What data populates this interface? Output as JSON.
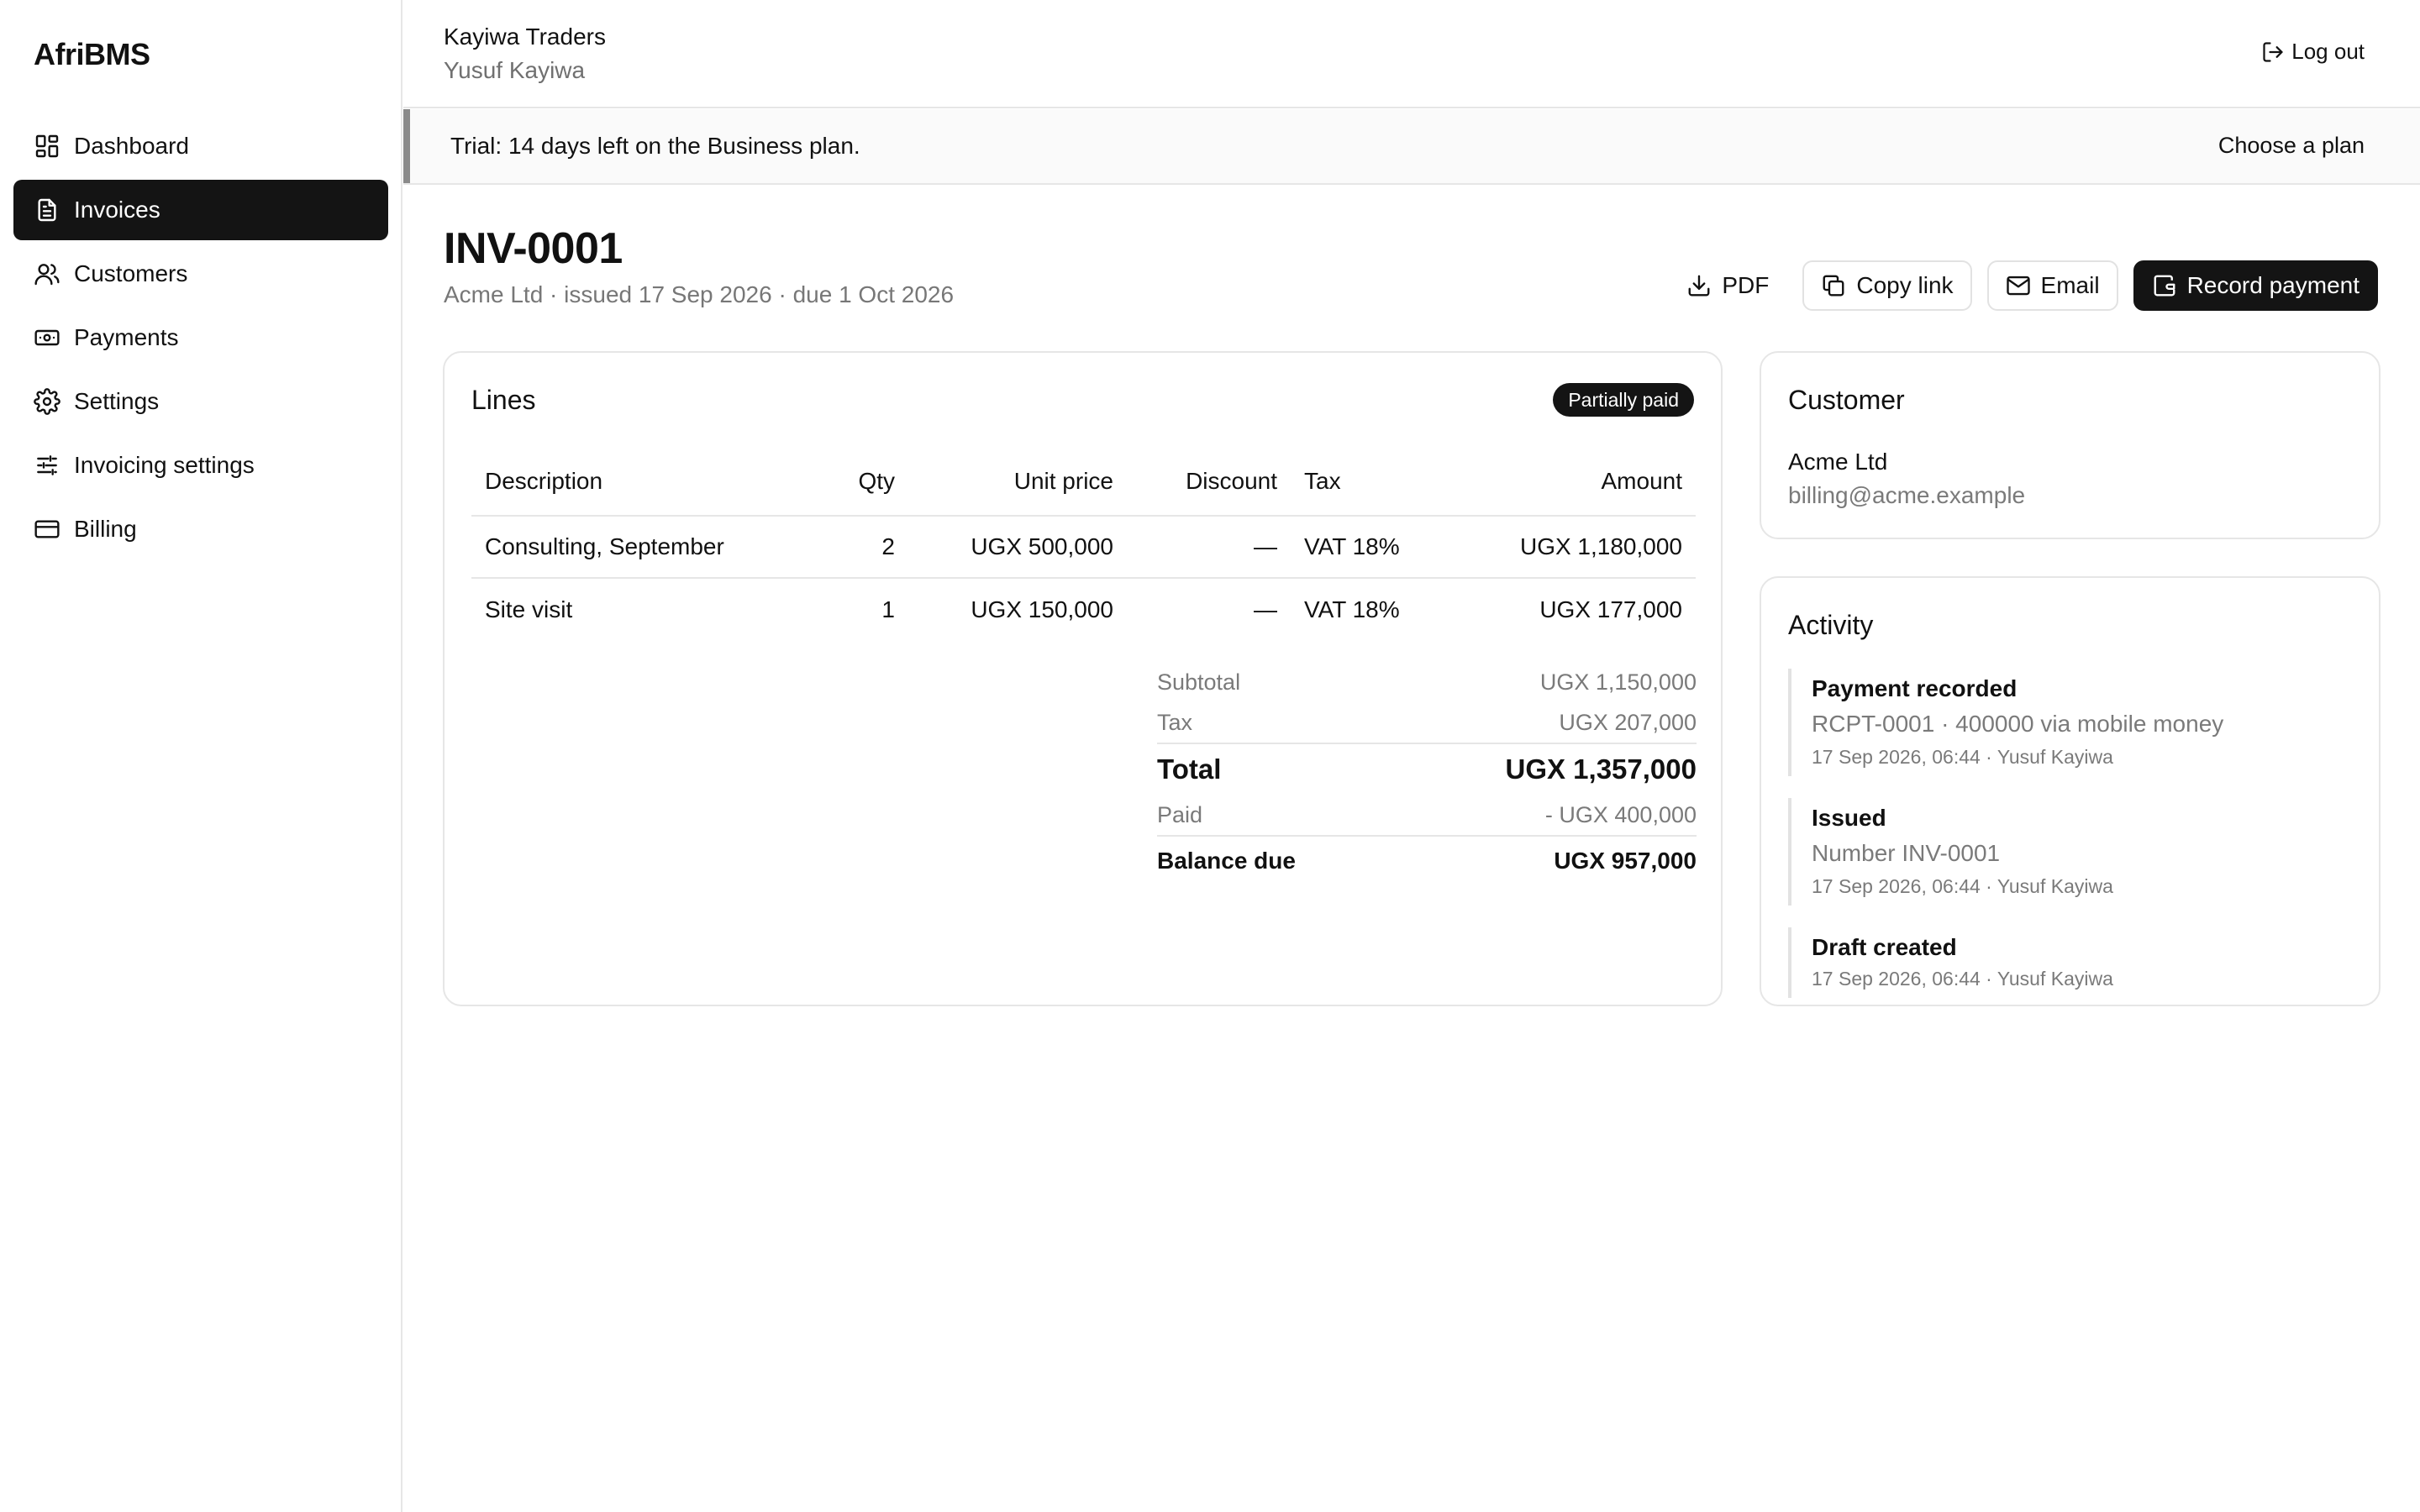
{
  "app": {
    "brand": "AfriBMS"
  },
  "sidebar": {
    "items": [
      {
        "label": "Dashboard",
        "icon": "dashboard-icon"
      },
      {
        "label": "Invoices",
        "icon": "document-icon",
        "active": true
      },
      {
        "label": "Customers",
        "icon": "users-icon"
      },
      {
        "label": "Payments",
        "icon": "banknote-icon"
      },
      {
        "label": "Settings",
        "icon": "gear-icon"
      },
      {
        "label": "Invoicing settings",
        "icon": "sliders-icon"
      },
      {
        "label": "Billing",
        "icon": "credit-card-icon"
      }
    ]
  },
  "header": {
    "org_name": "Kayiwa Traders",
    "user_name": "Yusuf Kayiwa",
    "logout_label": "Log out"
  },
  "banner": {
    "text": "Trial: 14 days left on the Business plan.",
    "link_label": "Choose a plan"
  },
  "invoice": {
    "number": "INV-0001",
    "meta": "Acme Ltd · issued 17 Sep 2026 · due 1 Oct 2026",
    "status": "Partially paid"
  },
  "actions": {
    "pdf": "PDF",
    "copy_link": "Copy link",
    "email": "Email",
    "record_payment": "Record payment"
  },
  "lines": {
    "title": "Lines",
    "columns": {
      "description": "Description",
      "qty": "Qty",
      "unit_price": "Unit price",
      "discount": "Discount",
      "tax": "Tax",
      "amount": "Amount"
    },
    "rows": [
      {
        "description": "Consulting, September",
        "qty": "2",
        "unit_price": "UGX 500,000",
        "discount": "—",
        "tax": "VAT 18%",
        "amount": "UGX 1,180,000"
      },
      {
        "description": "Site visit",
        "qty": "1",
        "unit_price": "UGX 150,000",
        "discount": "—",
        "tax": "VAT 18%",
        "amount": "UGX 177,000"
      }
    ]
  },
  "totals": {
    "subtotal_label": "Subtotal",
    "subtotal": "UGX 1,150,000",
    "tax_label": "Tax",
    "tax": "UGX 207,000",
    "total_label": "Total",
    "total": "UGX 1,357,000",
    "paid_label": "Paid",
    "paid": "- UGX 400,000",
    "balance_label": "Balance due",
    "balance": "UGX 957,000"
  },
  "customer": {
    "title": "Customer",
    "name": "Acme Ltd",
    "email": "billing@acme.example"
  },
  "activity": {
    "title": "Activity",
    "items": [
      {
        "title": "Payment recorded",
        "detail": "RCPT-0001 · 400000 via mobile money",
        "meta": "17 Sep 2026, 06:44 · Yusuf Kayiwa"
      },
      {
        "title": "Issued",
        "detail": "Number INV-0001",
        "meta": "17 Sep 2026, 06:44 · Yusuf Kayiwa"
      },
      {
        "title": "Draft created",
        "meta": "17 Sep 2026, 06:44 · Yusuf Kayiwa"
      }
    ]
  }
}
